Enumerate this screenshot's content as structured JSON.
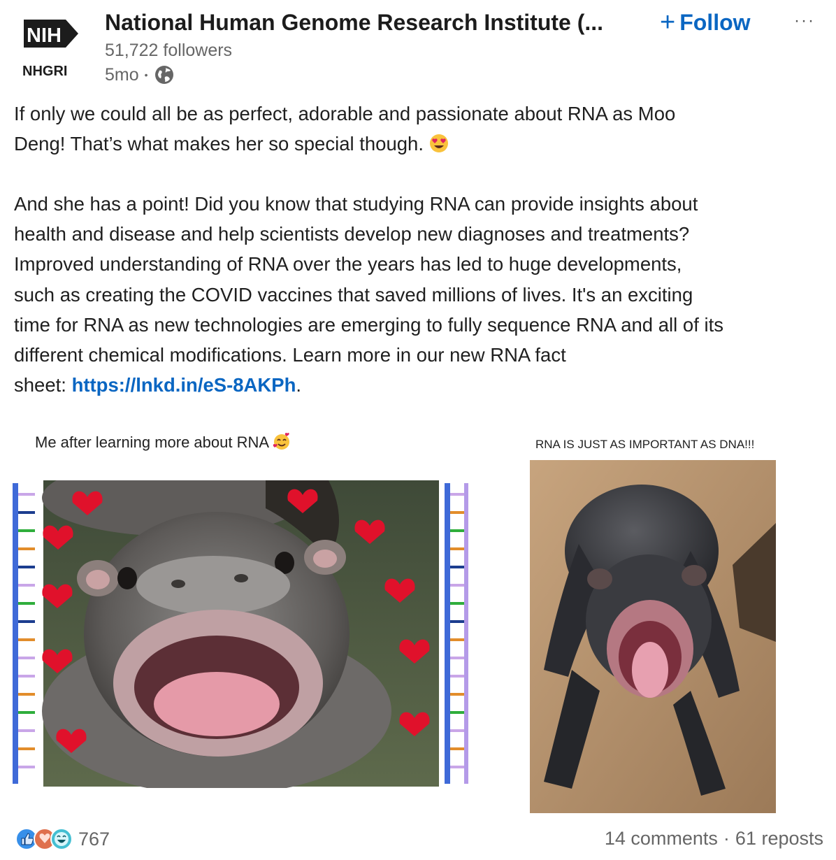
{
  "post": {
    "author": {
      "logo_text": "NIH",
      "logo_subtext": "NHGRI",
      "name": "National Human Genome Research Institute (...",
      "followers": "51,722 followers",
      "time": "5mo",
      "separator": "•"
    },
    "follow_label": "Follow",
    "follow_plus": "+",
    "more_label": "···",
    "text": {
      "p1_line1": "If only we could all be as perfect, adorable and passionate about RNA as Moo",
      "p1_line2": "Deng! That’s what makes her so special though.",
      "p2_line1": "And she has a point! Did you know that studying RNA can provide insights about",
      "p2_line2": "health and disease and help scientists develop new diagnoses and treatments?",
      "p2_line3": "Improved understanding of RNA over the years has led to huge developments,",
      "p2_line4": "such as creating the COVID vaccines that saved millions of lives. It's an exciting",
      "p2_line5": "time for RNA as new technologies are emerging to fully sequence RNA and all of its",
      "p2_line6": "different chemical modifications. Learn more in our new RNA fact",
      "p2_line7_prefix": "sheet: ",
      "link": "https://lnkd.in/eS-8AKPh",
      "p2_line7_suffix": "."
    },
    "images": {
      "left_caption": "Me after learning more about RNA",
      "right_caption": "RNA IS JUST AS IMPORTANT AS DNA!!!"
    },
    "footer": {
      "reaction_count": "767",
      "comments": "14 comments",
      "dot": "·",
      "reposts": "61 reposts"
    }
  },
  "colors": {
    "link": "#0a66c2",
    "muted": "#666666",
    "text": "#1f1f1f"
  },
  "icons": [
    "nih-logo",
    "globe-icon",
    "heart-eyes-emoji",
    "smiling-hearts-emoji",
    "like-reaction-icon",
    "love-reaction-icon",
    "funny-reaction-icon"
  ]
}
